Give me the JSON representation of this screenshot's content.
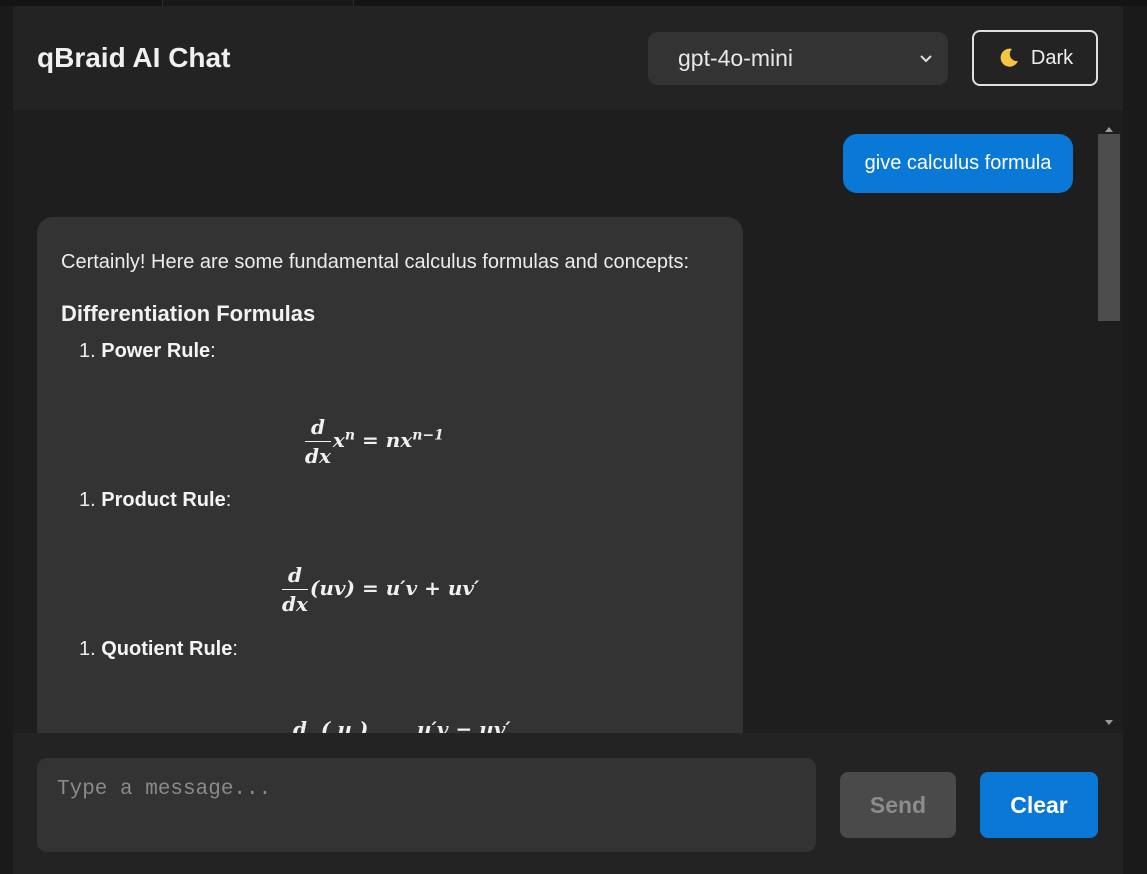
{
  "header": {
    "title": "qBraid AI Chat",
    "model_selected": "gpt-4o-mini",
    "theme_label": "Dark",
    "theme_icon": "moon-icon"
  },
  "messages": {
    "user": "give calculus formula",
    "assistant": {
      "intro": "Certainly! Here are some fundamental calculus formulas and concepts:",
      "section_title": "Differentiation Formulas",
      "items": [
        {
          "number": "1.",
          "name": "Power Rule",
          "suffix": ":"
        },
        {
          "number": "1.",
          "name": "Product Rule",
          "suffix": ":"
        },
        {
          "number": "1.",
          "name": "Quotient Rule",
          "suffix": ":"
        }
      ],
      "formulas": {
        "power": {
          "num": "d",
          "den": "dx",
          "lhs_base": "x",
          "lhs_exp": "n",
          "rhs_coeff": "= nx",
          "rhs_exp": "n−1"
        },
        "product": {
          "num": "d",
          "den": "dx",
          "arg": "(uv)",
          "rhs": "= u′v + uv′"
        },
        "quotient_partial": "d  ( u )       u′v − uv′"
      }
    }
  },
  "composer": {
    "placeholder": "Type a message...",
    "send_label": "Send",
    "clear_label": "Clear"
  },
  "colors": {
    "accent": "#0a78d6",
    "background": "#1e1e1e",
    "bubble": "#333333"
  }
}
